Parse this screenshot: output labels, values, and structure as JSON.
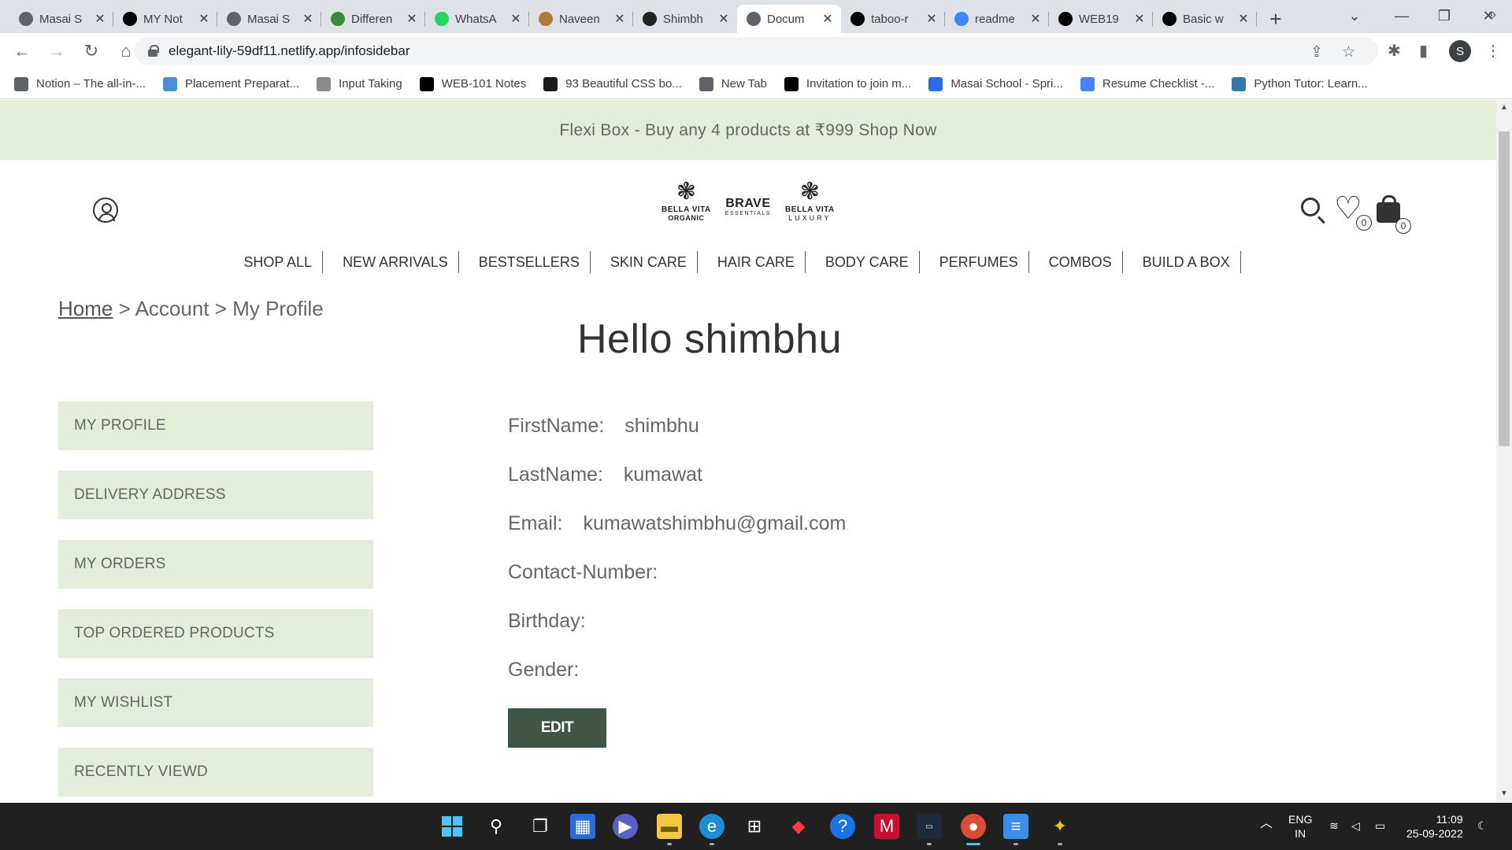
{
  "browser": {
    "tabs": [
      {
        "label": "Masai S",
        "icon": "globe-icon",
        "color": "#5f6368"
      },
      {
        "label": "MY Not",
        "icon": "notion-icon",
        "color": "#000000"
      },
      {
        "label": "Masai S",
        "icon": "globe-icon",
        "color": "#5f6368"
      },
      {
        "label": "Differen",
        "icon": "infinity-icon",
        "color": "#3a8a3a"
      },
      {
        "label": "WhatsA",
        "icon": "whatsapp-icon",
        "color": "#25d366"
      },
      {
        "label": "Naveen",
        "icon": "image-icon",
        "color": "#b07a3a"
      },
      {
        "label": "Shimbh",
        "icon": "site-icon",
        "color": "#222222"
      },
      {
        "label": "Docum",
        "icon": "globe-icon",
        "color": "#5f6368"
      },
      {
        "label": "taboo-r",
        "icon": "github-icon",
        "color": "#000000"
      },
      {
        "label": "readme",
        "icon": "google-icon",
        "color": "#4285f4"
      },
      {
        "label": "WEB19",
        "icon": "github-icon",
        "color": "#000000"
      },
      {
        "label": "Basic w",
        "icon": "github-icon",
        "color": "#000000"
      }
    ],
    "active_tab_index": 7,
    "url": "elegant-lily-59df11.netlify.app/infosidebar",
    "profile_initial": "S",
    "bookmarks": [
      {
        "label": "Notion – The all-in-...",
        "icon": "link-icon",
        "color": "#5f6368"
      },
      {
        "label": "Placement Preparat...",
        "icon": "infinity-icon",
        "color": "#4a90d9"
      },
      {
        "label": "Input Taking",
        "icon": "number-one-icon",
        "color": "#8a8a8a"
      },
      {
        "label": "WEB-101 Notes",
        "icon": "notion-icon",
        "color": "#000000"
      },
      {
        "label": "93 Beautiful CSS bo...",
        "icon": "css-icon",
        "color": "#1a1a1a"
      },
      {
        "label": "New Tab",
        "icon": "globe-icon",
        "color": "#5f6368"
      },
      {
        "label": "Invitation to join m...",
        "icon": "github-icon",
        "color": "#000000"
      },
      {
        "label": "Masai School - Spri...",
        "icon": "masai-icon",
        "color": "#2d6cdf"
      },
      {
        "label": "Resume Checklist -...",
        "icon": "docs-icon",
        "color": "#4285f4"
      },
      {
        "label": "Python Tutor: Learn...",
        "icon": "python-icon",
        "color": "#3776ab"
      }
    ]
  },
  "page": {
    "announcement": "Flexi Box - Buy any 4 products at ₹999 Shop Now",
    "logos": {
      "organic": {
        "line1": "BELLA VITA",
        "line2": "ORGANIC"
      },
      "brave": {
        "line1": "BRAVE",
        "line2": "ESSENTIALS"
      },
      "luxury": {
        "line1": "BELLA VITA",
        "line2": "LUXURY"
      }
    },
    "wishlist_count": "0",
    "cart_count": "0",
    "nav": [
      "SHOP ALL",
      "NEW ARRIVALS",
      "BESTSELLERS",
      "SKIN CARE",
      "HAIR CARE",
      "BODY CARE",
      "PERFUMES",
      "COMBOS",
      "BUILD A BOX"
    ],
    "breadcrumb": {
      "home": "Home",
      "sep": ">",
      "account": "Account",
      "current": "My Profile"
    },
    "greeting": "Hello shimbhu",
    "sidebar": [
      "MY PROFILE",
      "DELIVERY ADDRESS",
      "MY ORDERS",
      "TOP ORDERED PRODUCTS",
      "MY WISHLIST",
      "RECENTLY VIEWD"
    ],
    "profile": [
      {
        "label": "FirstName:",
        "value": "shimbhu"
      },
      {
        "label": "LastName:",
        "value": "kumawat"
      },
      {
        "label": "Email:",
        "value": "kumawatshimbhu@gmail.com"
      },
      {
        "label": "Contact-Number:",
        "value": ""
      },
      {
        "label": "Birthday:",
        "value": ""
      },
      {
        "label": "Gender:",
        "value": ""
      }
    ],
    "edit_label": "EDIT",
    "colors": {
      "accent_green": "#3f5546",
      "panel_green": "#e3edd9"
    }
  },
  "taskbar": {
    "lang_top": "ENG",
    "lang_bottom": "IN",
    "time": "11:09",
    "date": "25-09-2022"
  }
}
